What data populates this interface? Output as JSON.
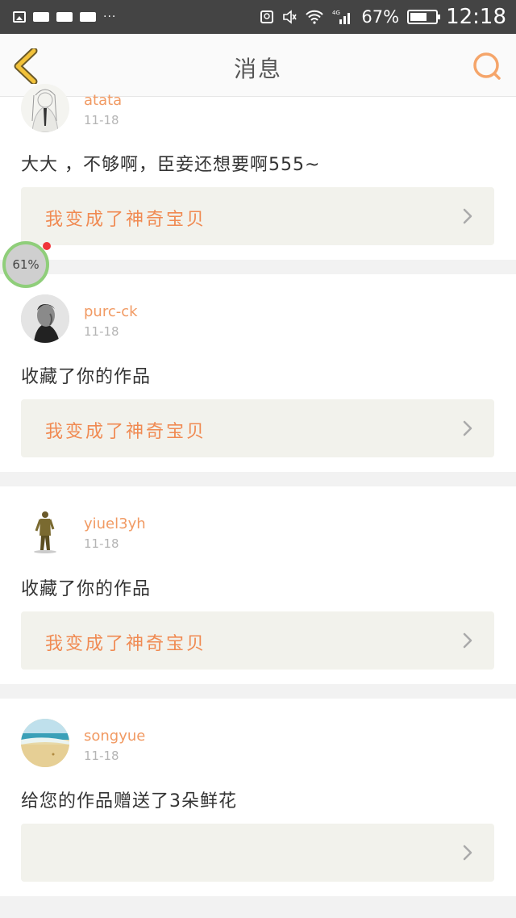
{
  "status_bar": {
    "dots": "···",
    "battery_percent": "67%",
    "battery_level": 0.67,
    "time": "12:18",
    "network": "4G"
  },
  "header": {
    "title": "消息",
    "back_icon": "back-chevron-icon",
    "search_icon": "search-icon"
  },
  "colors": {
    "accent": "#f19a63",
    "link_text": "#f08a52",
    "link_bg": "#f2f2ec"
  },
  "floating_badge": {
    "text": "61%"
  },
  "messages": [
    {
      "username": "atata",
      "time": "11-18",
      "text": "大大 ，不够啊，臣妾还想要啊555~",
      "link": "我变成了神奇宝贝"
    },
    {
      "username": "purc-ck",
      "time": "11-18",
      "text": "收藏了你的作品",
      "link": "我变成了神奇宝贝"
    },
    {
      "username": "yiuel3yh",
      "time": "11-18",
      "text": "收藏了你的作品",
      "link": "我变成了神奇宝贝"
    },
    {
      "username": "songyue",
      "time": "11-18",
      "text": "给您的作品赠送了3朵鲜花",
      "link": ""
    }
  ]
}
